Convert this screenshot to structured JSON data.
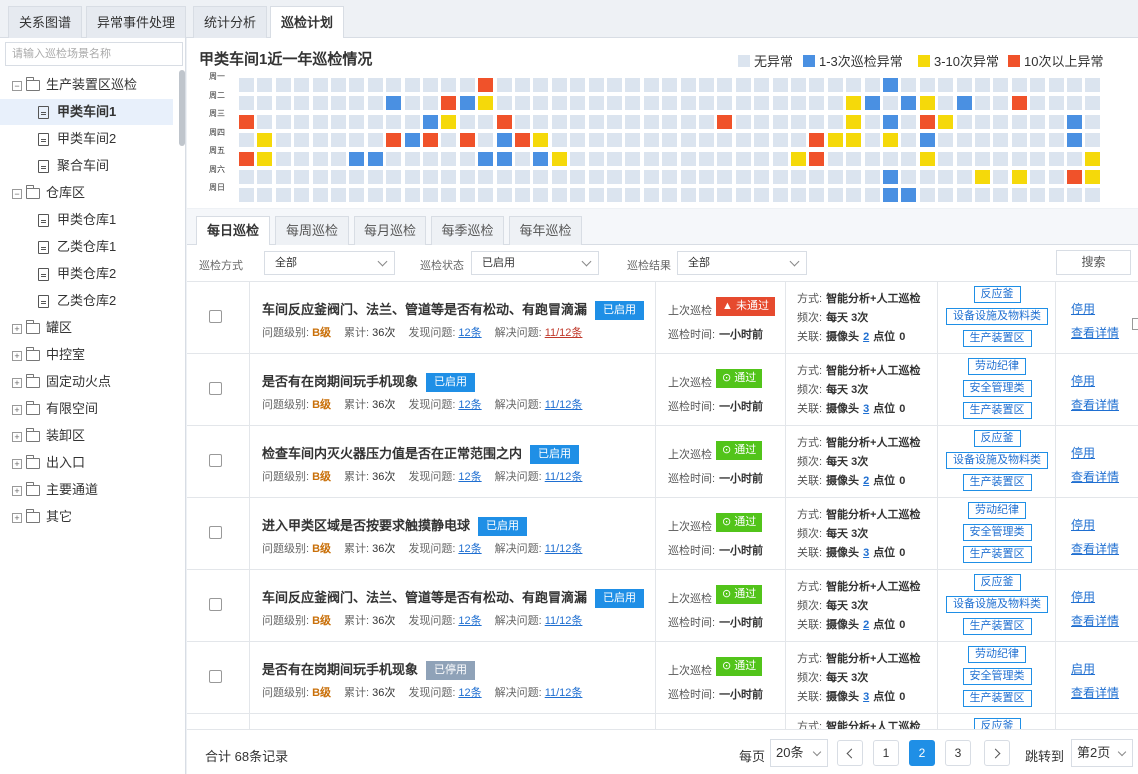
{
  "top_tabs": [
    "关系图谱",
    "异常事件处理",
    "统计分析",
    "巡检计划"
  ],
  "sidebar": {
    "search_placeholder": "请输入巡检场景名称",
    "nodes": [
      {
        "label": "生产装置区巡检",
        "type": "folder",
        "toggle": "⊟"
      },
      {
        "label": "甲类车间1",
        "type": "doc",
        "selected": true
      },
      {
        "label": "甲类车间2",
        "type": "doc"
      },
      {
        "label": "聚合车间",
        "type": "doc"
      },
      {
        "label": "仓库区",
        "type": "folder",
        "toggle": "⊟"
      },
      {
        "label": "甲类仓库1",
        "type": "doc"
      },
      {
        "label": "乙类仓库1",
        "type": "doc"
      },
      {
        "label": "甲类仓库2",
        "type": "doc"
      },
      {
        "label": "乙类仓库2",
        "type": "doc"
      },
      {
        "label": "罐区",
        "type": "folder",
        "toggle": "⊞"
      },
      {
        "label": "中控室",
        "type": "folder",
        "toggle": "⊞"
      },
      {
        "label": "固定动火点",
        "type": "folder",
        "toggle": "⊞"
      },
      {
        "label": "有限空间",
        "type": "folder",
        "toggle": "⊞"
      },
      {
        "label": "装卸区",
        "type": "folder",
        "toggle": "⊞"
      },
      {
        "label": "出入口",
        "type": "folder",
        "toggle": "⊞"
      },
      {
        "label": "主要通道",
        "type": "folder",
        "toggle": "⊞"
      },
      {
        "label": "其它",
        "type": "folder",
        "toggle": "⊞"
      }
    ]
  },
  "heatmap": {
    "title": "甲类车间1近一年巡检情况",
    "legend": [
      {
        "label": "无异常",
        "color": "#dbe4ef"
      },
      {
        "label": "1-3次巡检异常",
        "color": "#4a90e2"
      },
      {
        "label": "3-10次异常",
        "color": "#f5d90a"
      },
      {
        "label": "10次以上异常",
        "color": "#f0522a"
      }
    ],
    "days": [
      "周一",
      "周二",
      "周三",
      "周四",
      "周五",
      "周六",
      "周日"
    ],
    "weeks": 47,
    "cells": [
      [
        0,
        0,
        0,
        0,
        0,
        0,
        0,
        0,
        0,
        0,
        0,
        0,
        0,
        3,
        0,
        0,
        0,
        0,
        0,
        0,
        0,
        0,
        0,
        0,
        0,
        0,
        0,
        0,
        0,
        0,
        0,
        0,
        0,
        0,
        0,
        1,
        0,
        0,
        0,
        0,
        0,
        0,
        0,
        0,
        0,
        0,
        0
      ],
      [
        0,
        0,
        0,
        0,
        0,
        0,
        0,
        0,
        1,
        0,
        0,
        3,
        1,
        2,
        0,
        0,
        0,
        0,
        0,
        0,
        0,
        0,
        0,
        0,
        0,
        0,
        0,
        0,
        0,
        0,
        0,
        0,
        0,
        2,
        1,
        0,
        1,
        2,
        0,
        1,
        0,
        0,
        3,
        0,
        0,
        0,
        0
      ],
      [
        3,
        0,
        0,
        0,
        0,
        0,
        0,
        0,
        0,
        0,
        1,
        2,
        0,
        0,
        3,
        0,
        0,
        0,
        0,
        0,
        0,
        0,
        0,
        0,
        0,
        0,
        3,
        0,
        0,
        0,
        0,
        0,
        0,
        2,
        0,
        1,
        0,
        3,
        2,
        0,
        0,
        0,
        0,
        0,
        0,
        1,
        0
      ],
      [
        0,
        2,
        0,
        0,
        0,
        0,
        0,
        0,
        3,
        1,
        3,
        0,
        3,
        0,
        1,
        3,
        2,
        0,
        0,
        0,
        0,
        0,
        0,
        0,
        0,
        0,
        0,
        0,
        0,
        0,
        0,
        3,
        2,
        2,
        0,
        2,
        0,
        1,
        0,
        0,
        0,
        0,
        0,
        0,
        0,
        1,
        0
      ],
      [
        3,
        2,
        0,
        0,
        0,
        0,
        1,
        1,
        0,
        0,
        0,
        0,
        0,
        1,
        1,
        0,
        1,
        2,
        0,
        0,
        0,
        0,
        0,
        0,
        0,
        0,
        0,
        0,
        0,
        0,
        2,
        3,
        0,
        0,
        0,
        0,
        0,
        2,
        0,
        0,
        0,
        0,
        0,
        0,
        0,
        0,
        2
      ],
      [
        0,
        0,
        0,
        0,
        0,
        0,
        0,
        0,
        0,
        0,
        0,
        0,
        0,
        0,
        0,
        0,
        0,
        0,
        0,
        0,
        0,
        0,
        0,
        0,
        0,
        0,
        0,
        0,
        0,
        0,
        0,
        0,
        0,
        0,
        0,
        1,
        0,
        0,
        0,
        0,
        2,
        0,
        2,
        0,
        0,
        3,
        2
      ],
      [
        0,
        0,
        0,
        0,
        0,
        0,
        0,
        0,
        0,
        0,
        0,
        0,
        0,
        0,
        0,
        0,
        0,
        0,
        0,
        0,
        0,
        0,
        0,
        0,
        0,
        0,
        0,
        0,
        0,
        0,
        0,
        0,
        0,
        0,
        0,
        1,
        1,
        0,
        0,
        0,
        0,
        0,
        0,
        0,
        0,
        0,
        0
      ]
    ]
  },
  "list_tabs": [
    "每日巡检",
    "每周巡检",
    "每月巡检",
    "每季巡检",
    "每年巡检"
  ],
  "filters": {
    "method_label": "巡检方式",
    "method_value": "全部",
    "status_label": "巡检状态",
    "status_value": "已启用",
    "result_label": "巡检结果",
    "result_value": "全部",
    "search_label": "搜索"
  },
  "row_labels": {
    "level": "问题级别:",
    "total": "累计:",
    "found": "发现问题:",
    "resolved": "解决问题:",
    "last": "上次巡检",
    "time": "巡检时间:",
    "method": "方式:",
    "freq": "频次:",
    "rel": "关联:",
    "camera": "摄像头",
    "point": "点位"
  },
  "rows": [
    {
      "question": "车间反应釜阀门、法兰、管道等是否有松动、有跑冒滴漏",
      "status": "已启用",
      "status_on": true,
      "level": "B级",
      "total": "36次",
      "found": "12条",
      "resolved": "11/12条",
      "resolved_red": true,
      "result": "未通过",
      "result_pass": false,
      "time": "一小时前",
      "method": "智能分析+人工巡检",
      "freq": "每天 3次",
      "cam": "2",
      "pt": "0",
      "tags": [
        "反应釜",
        "设备设施及物料类",
        "生产装置区"
      ],
      "action": "停用",
      "detail": "查看详情"
    },
    {
      "question": "是否有在岗期间玩手机现象",
      "status": "已启用",
      "status_on": true,
      "level": "B级",
      "total": "36次",
      "found": "12条",
      "resolved": "11/12条",
      "resolved_red": false,
      "result": "通过",
      "result_pass": true,
      "time": "一小时前",
      "method": "智能分析+人工巡检",
      "freq": "每天 3次",
      "cam": "3",
      "pt": "0",
      "tags": [
        "劳动纪律",
        "安全管理类",
        "生产装置区"
      ],
      "action": "停用",
      "detail": "查看详情"
    },
    {
      "question": "检查车间内灭火器压力值是否在正常范围之内",
      "status": "已启用",
      "status_on": true,
      "level": "B级",
      "total": "36次",
      "found": "12条",
      "resolved": "11/12条",
      "resolved_red": false,
      "result": "通过",
      "result_pass": true,
      "time": "一小时前",
      "method": "智能分析+人工巡检",
      "freq": "每天 3次",
      "cam": "2",
      "pt": "0",
      "tags": [
        "反应釜",
        "设备设施及物料类",
        "生产装置区"
      ],
      "action": "停用",
      "detail": "查看详情"
    },
    {
      "question": "进入甲类区域是否按要求触摸静电球",
      "status": "已启用",
      "status_on": true,
      "level": "B级",
      "total": "36次",
      "found": "12条",
      "resolved": "11/12条",
      "resolved_red": false,
      "result": "通过",
      "result_pass": true,
      "time": "一小时前",
      "method": "智能分析+人工巡检",
      "freq": "每天 3次",
      "cam": "3",
      "pt": "0",
      "tags": [
        "劳动纪律",
        "安全管理类",
        "生产装置区"
      ],
      "action": "停用",
      "detail": "查看详情"
    },
    {
      "question": "车间反应釜阀门、法兰、管道等是否有松动、有跑冒滴漏",
      "status": "已启用",
      "status_on": true,
      "level": "B级",
      "total": "36次",
      "found": "12条",
      "resolved": "11/12条",
      "resolved_red": false,
      "result": "通过",
      "result_pass": true,
      "time": "一小时前",
      "method": "智能分析+人工巡检",
      "freq": "每天 3次",
      "cam": "2",
      "pt": "0",
      "tags": [
        "反应釜",
        "设备设施及物料类",
        "生产装置区"
      ],
      "action": "停用",
      "detail": "查看详情"
    },
    {
      "question": "是否有在岗期间玩手机现象",
      "status": "已停用",
      "status_on": false,
      "level": "B级",
      "total": "36次",
      "found": "12条",
      "resolved": "11/12条",
      "resolved_red": false,
      "result": "通过",
      "result_pass": true,
      "time": "一小时前",
      "method": "智能分析+人工巡检",
      "freq": "每天 3次",
      "cam": "3",
      "pt": "0",
      "tags": [
        "劳动纪律",
        "安全管理类",
        "生产装置区"
      ],
      "action": "启用",
      "detail": "查看详情"
    },
    {
      "question": "",
      "status": "",
      "status_on": true,
      "level": "",
      "total": "",
      "found": "",
      "resolved": "",
      "resolved_red": false,
      "result": "",
      "result_pass": true,
      "time": "",
      "method": "智能分析+人工巡检",
      "freq": "",
      "cam": "",
      "pt": "",
      "tags": [
        "反应釜"
      ],
      "action": "",
      "detail": ""
    }
  ],
  "pagination": {
    "total": "合计 68条记录",
    "per_page_label": "每页",
    "per_page_value": "20条",
    "pages": [
      "1",
      "2",
      "3"
    ],
    "current": "2",
    "jump_label": "跳转到",
    "jump_value": "第2页"
  }
}
